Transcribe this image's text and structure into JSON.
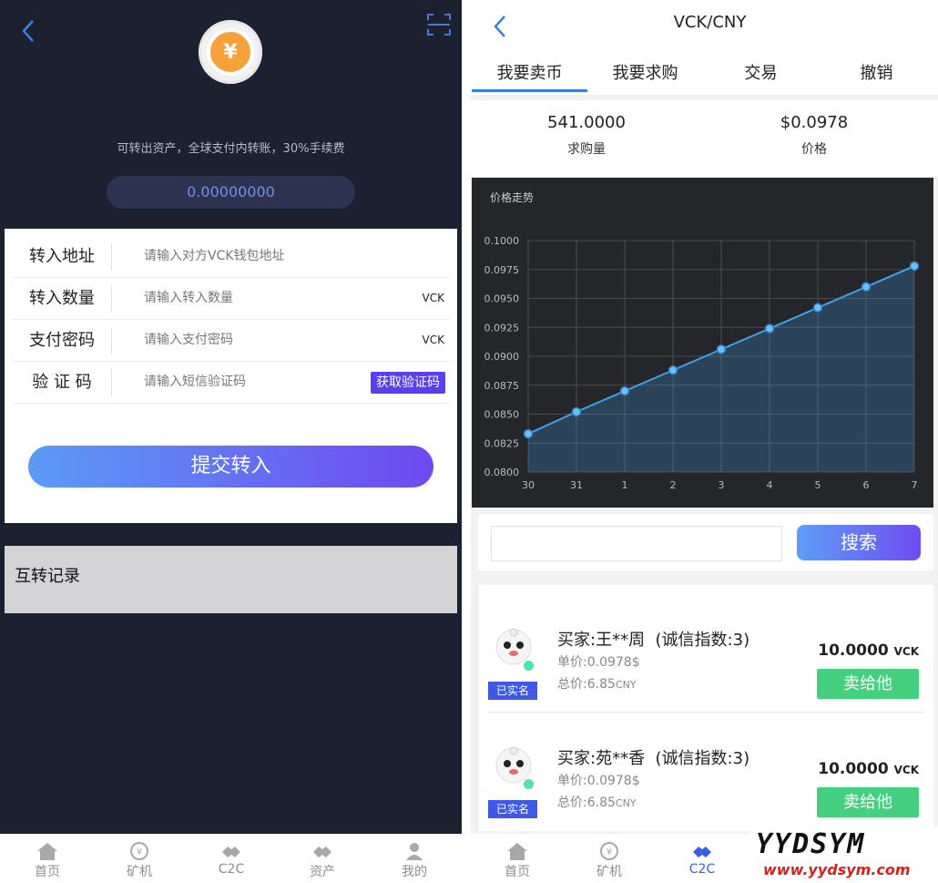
{
  "left": {
    "notice": "可转出资产，全球支付内转账，30%手续费",
    "balance": "0.00000000",
    "form": {
      "address": {
        "label": "转入地址",
        "placeholder": "请输入对方VCK钱包地址"
      },
      "amount": {
        "label": "转入数量",
        "placeholder": "请输入转入数量",
        "unit": "VCK"
      },
      "password": {
        "label": "支付密码",
        "placeholder": "请输入支付密码",
        "unit": "VCK"
      },
      "code": {
        "label": "验 证 码",
        "placeholder": "请输入短信验证码",
        "button": "获取验证码"
      }
    },
    "submit_label": "提交转入",
    "records_title": "互转记录",
    "nav": [
      {
        "label": "首页",
        "icon": "home-icon"
      },
      {
        "label": "矿机",
        "icon": "miner-icon"
      },
      {
        "label": "C2C",
        "icon": "c2c-icon"
      },
      {
        "label": "资产",
        "icon": "assets-icon"
      },
      {
        "label": "我的",
        "icon": "user-icon"
      }
    ]
  },
  "right": {
    "pair": "VCK/CNY",
    "tabs": [
      "我要卖币",
      "我要求购",
      "交易",
      "撤销"
    ],
    "active_tab": 0,
    "stats": [
      {
        "value": "541.0000",
        "label": "求购量"
      },
      {
        "value": "$0.0978",
        "label": "价格"
      }
    ],
    "chart_title": "价格走势",
    "search_label": "搜索",
    "orders": [
      {
        "buyer": "买家:王**周",
        "credit": "(诚信指数:3)",
        "verified": "已实名",
        "unit_price": "单价:0.0978$",
        "total": "总价:6.85",
        "total_unit": "CNY",
        "amount": "10.0000",
        "amount_unit": "VCK",
        "action": "卖给他"
      },
      {
        "buyer": "买家:苑**香",
        "credit": "(诚信指数:3)",
        "verified": "已实名",
        "unit_price": "单价:0.0978$",
        "total": "总价:6.85",
        "total_unit": "CNY",
        "amount": "10.0000",
        "amount_unit": "VCK",
        "action": "卖给他"
      }
    ],
    "nav": [
      {
        "label": "首页",
        "icon": "home-icon",
        "active": false
      },
      {
        "label": "矿机",
        "icon": "miner-icon",
        "active": false
      },
      {
        "label": "C2C",
        "icon": "c2c-icon",
        "active": true
      }
    ]
  },
  "watermark": {
    "brand": "YYDSYM",
    "url": "www.yydsym.com"
  },
  "colors": {
    "accent": "#6e49f1",
    "sell": "#43d17f",
    "line": "#3fa0e8",
    "nav_active": "#3a5fe6"
  },
  "chart_data": {
    "type": "area",
    "title": "价格走势",
    "x": [
      "30",
      "31",
      "1",
      "2",
      "3",
      "4",
      "5",
      "6",
      "7"
    ],
    "series": [
      {
        "values": [
          0.0833,
          0.0852,
          0.087,
          0.0888,
          0.0906,
          0.0924,
          0.0942,
          0.096,
          0.0978
        ]
      }
    ],
    "ylim": [
      0.08,
      0.1
    ],
    "yticks": [
      "0.1000",
      "0.0975",
      "0.0950",
      "0.0925",
      "0.0900",
      "0.0875",
      "0.0850",
      "0.0825",
      "0.0800"
    ],
    "grid": true
  }
}
